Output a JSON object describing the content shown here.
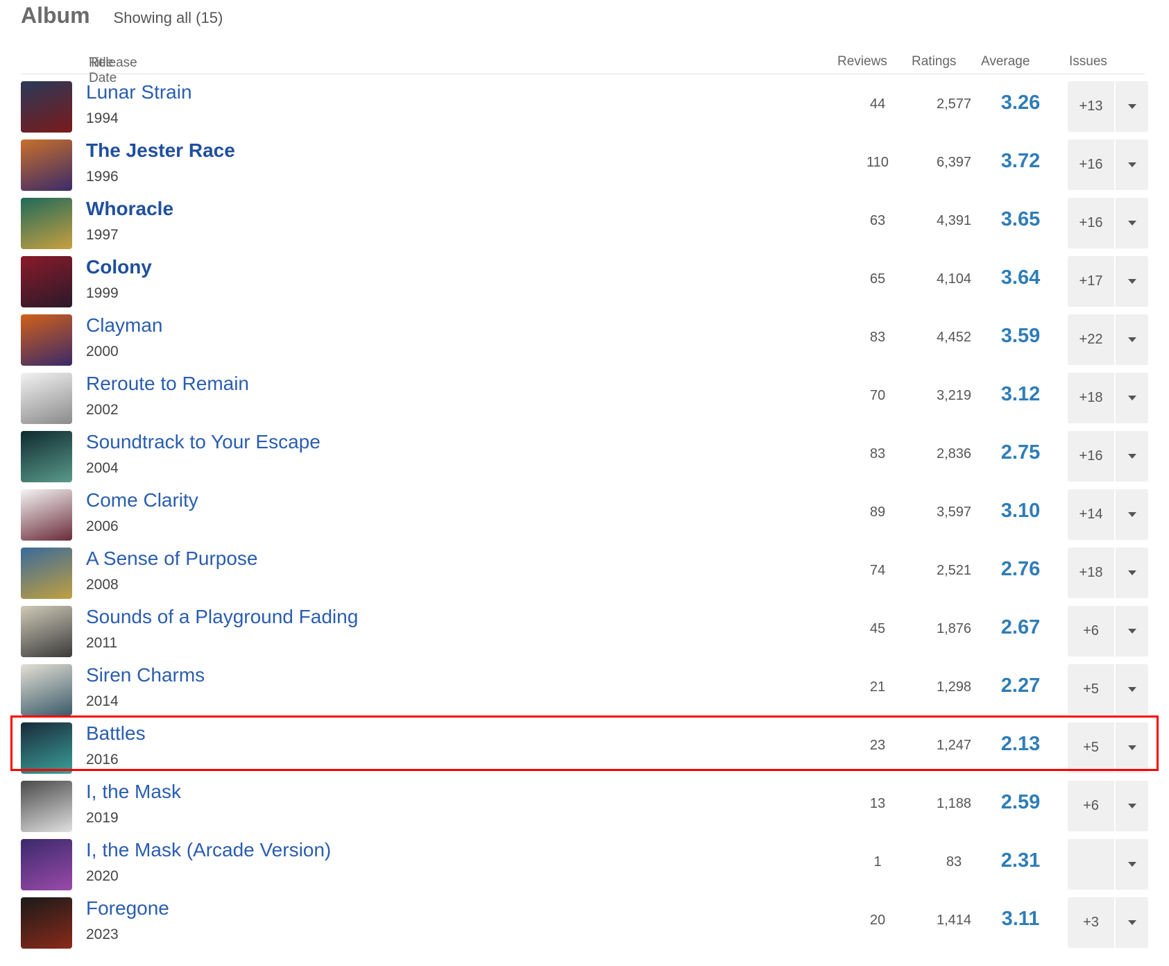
{
  "section": {
    "title": "Album",
    "showing": "Showing all (15)"
  },
  "columns": {
    "title": "Title",
    "separator": "/",
    "release_date": "Release Date",
    "reviews": "Reviews",
    "ratings": "Ratings",
    "average": "Average",
    "issues": "Issues"
  },
  "colors": {
    "title_link": "#2a5db0",
    "average": "#2f7db7",
    "highlight": "#ff0000",
    "issue_bg": "#f0f0f0"
  },
  "albums": [
    {
      "title": "Lunar Strain",
      "year": "1994",
      "reviews": "44",
      "ratings": "2,577",
      "average": "3.26",
      "issues": "+13",
      "bold": false,
      "cover": [
        "#2a3a5a",
        "#7a1a1a"
      ]
    },
    {
      "title": "The Jester Race",
      "year": "1996",
      "reviews": "110",
      "ratings": "6,397",
      "average": "3.72",
      "issues": "+16",
      "bold": true,
      "cover": [
        "#c8702a",
        "#3a2a6a"
      ]
    },
    {
      "title": "Whoracle",
      "year": "1997",
      "reviews": "63",
      "ratings": "4,391",
      "average": "3.65",
      "issues": "+16",
      "bold": true,
      "cover": [
        "#1f6a5a",
        "#c8a040"
      ]
    },
    {
      "title": "Colony",
      "year": "1999",
      "reviews": "65",
      "ratings": "4,104",
      "average": "3.64",
      "issues": "+17",
      "bold": true,
      "cover": [
        "#8a1a2a",
        "#2a1a2a"
      ]
    },
    {
      "title": "Clayman",
      "year": "2000",
      "reviews": "83",
      "ratings": "4,452",
      "average": "3.59",
      "issues": "+22",
      "bold": false,
      "cover": [
        "#d0601a",
        "#3a2a6a"
      ]
    },
    {
      "title": "Reroute to Remain",
      "year": "2002",
      "reviews": "70",
      "ratings": "3,219",
      "average": "3.12",
      "issues": "+18",
      "bold": false,
      "cover": [
        "#f2f2f2",
        "#8a8a8a"
      ]
    },
    {
      "title": "Soundtrack to Your Escape",
      "year": "2004",
      "reviews": "83",
      "ratings": "2,836",
      "average": "2.75",
      "issues": "+16",
      "bold": false,
      "cover": [
        "#0f2a30",
        "#5a9a8a"
      ]
    },
    {
      "title": "Come Clarity",
      "year": "2006",
      "reviews": "89",
      "ratings": "3,597",
      "average": "3.10",
      "issues": "+14",
      "bold": false,
      "cover": [
        "#f4f4f4",
        "#6a2a3a"
      ]
    },
    {
      "title": "A Sense of Purpose",
      "year": "2008",
      "reviews": "74",
      "ratings": "2,521",
      "average": "2.76",
      "issues": "+18",
      "bold": false,
      "cover": [
        "#3a6a9a",
        "#c0a040"
      ]
    },
    {
      "title": "Sounds of a Playground Fading",
      "year": "2011",
      "reviews": "45",
      "ratings": "1,876",
      "average": "2.67",
      "issues": "+6",
      "bold": false,
      "cover": [
        "#cfcab8",
        "#3a3a3a"
      ]
    },
    {
      "title": "Siren Charms",
      "year": "2014",
      "reviews": "21",
      "ratings": "1,298",
      "average": "2.27",
      "issues": "+5",
      "bold": false,
      "cover": [
        "#e4e0d4",
        "#3a5a6a"
      ]
    },
    {
      "title": "Battles",
      "year": "2016",
      "reviews": "23",
      "ratings": "1,247",
      "average": "2.13",
      "issues": "+5",
      "bold": false,
      "cover": [
        "#1a2a3a",
        "#3aa09a"
      ]
    },
    {
      "title": "I, the Mask",
      "year": "2019",
      "reviews": "13",
      "ratings": "1,188",
      "average": "2.59",
      "issues": "+6",
      "bold": false,
      "cover": [
        "#4a4a4a",
        "#e0e0e0"
      ]
    },
    {
      "title": "I, the Mask (Arcade Version)",
      "year": "2020",
      "reviews": "1",
      "ratings": "83",
      "average": "2.31",
      "issues": "",
      "bold": false,
      "cover": [
        "#3a2a6a",
        "#9a4aaa"
      ]
    },
    {
      "title": "Foregone",
      "year": "2023",
      "reviews": "20",
      "ratings": "1,414",
      "average": "3.11",
      "issues": "+3",
      "bold": false,
      "cover": [
        "#1a1a1a",
        "#8a2a1a"
      ]
    }
  ]
}
